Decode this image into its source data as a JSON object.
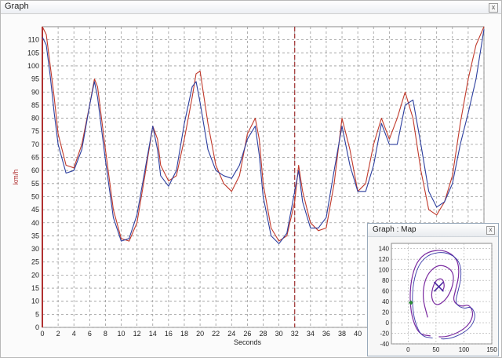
{
  "window": {
    "title": "Graph",
    "close_label": "x"
  },
  "chart_data": {
    "type": "line",
    "xlabel": "Seconds",
    "ylabel": "km/h",
    "xlim": [
      0,
      56
    ],
    "ylim": [
      0,
      115
    ],
    "xticks": [
      0,
      2,
      4,
      6,
      8,
      10,
      12,
      14,
      16,
      18,
      20,
      22,
      24,
      26,
      28,
      30,
      32,
      34,
      36,
      38,
      40
    ],
    "yticks": [
      0,
      5,
      10,
      15,
      20,
      25,
      30,
      35,
      40,
      45,
      50,
      55,
      60,
      65,
      70,
      75,
      80,
      85,
      90,
      95,
      100,
      105,
      110
    ],
    "marker_x": 32,
    "grid": true,
    "series": [
      {
        "color": "#c0392b",
        "points": [
          [
            0,
            115
          ],
          [
            0.5,
            112
          ],
          [
            1,
            100
          ],
          [
            1.5,
            88
          ],
          [
            2,
            74
          ],
          [
            3,
            62
          ],
          [
            4,
            61
          ],
          [
            5,
            70
          ],
          [
            6,
            85
          ],
          [
            6.6,
            95
          ],
          [
            7,
            92
          ],
          [
            8,
            68
          ],
          [
            9,
            45
          ],
          [
            10,
            34
          ],
          [
            11,
            33
          ],
          [
            12,
            40
          ],
          [
            13,
            58
          ],
          [
            14,
            77
          ],
          [
            14.6,
            72
          ],
          [
            15,
            62
          ],
          [
            16,
            56
          ],
          [
            17,
            58
          ],
          [
            18,
            72
          ],
          [
            19,
            88
          ],
          [
            19.5,
            97
          ],
          [
            20,
            98
          ],
          [
            21,
            78
          ],
          [
            22,
            62
          ],
          [
            23,
            55
          ],
          [
            24,
            52
          ],
          [
            25,
            58
          ],
          [
            26,
            74
          ],
          [
            27,
            80
          ],
          [
            27.5,
            72
          ],
          [
            28,
            55
          ],
          [
            29,
            38
          ],
          [
            30,
            33
          ],
          [
            31,
            35
          ],
          [
            32,
            48
          ],
          [
            32.5,
            62
          ],
          [
            33,
            52
          ],
          [
            34,
            40
          ],
          [
            35,
            37
          ],
          [
            36,
            38
          ],
          [
            37,
            55
          ],
          [
            38,
            80
          ],
          [
            39,
            68
          ],
          [
            40,
            52
          ],
          [
            41,
            55
          ],
          [
            42,
            70
          ],
          [
            43,
            80
          ],
          [
            44,
            72
          ],
          [
            45,
            80
          ],
          [
            46,
            90
          ],
          [
            47,
            80
          ],
          [
            48,
            60
          ],
          [
            49,
            45
          ],
          [
            50,
            43
          ],
          [
            51,
            48
          ],
          [
            52,
            58
          ],
          [
            53,
            78
          ],
          [
            54,
            95
          ],
          [
            55,
            108
          ],
          [
            56,
            115
          ]
        ]
      },
      {
        "color": "#2c3e9e",
        "points": [
          [
            0,
            111
          ],
          [
            0.5,
            108
          ],
          [
            1,
            96
          ],
          [
            1.5,
            82
          ],
          [
            2,
            70
          ],
          [
            3,
            59
          ],
          [
            4,
            60
          ],
          [
            5,
            68
          ],
          [
            6,
            85
          ],
          [
            6.6,
            94
          ],
          [
            7,
            88
          ],
          [
            8,
            64
          ],
          [
            9,
            42
          ],
          [
            10,
            33
          ],
          [
            11,
            34
          ],
          [
            12,
            43
          ],
          [
            13,
            60
          ],
          [
            14,
            77
          ],
          [
            14.6,
            68
          ],
          [
            15,
            58
          ],
          [
            16,
            54
          ],
          [
            17,
            60
          ],
          [
            18,
            78
          ],
          [
            19,
            92
          ],
          [
            19.5,
            94
          ],
          [
            20,
            86
          ],
          [
            21,
            68
          ],
          [
            22,
            60
          ],
          [
            23,
            58
          ],
          [
            24,
            57
          ],
          [
            25,
            62
          ],
          [
            26,
            72
          ],
          [
            27,
            77
          ],
          [
            27.5,
            66
          ],
          [
            28,
            50
          ],
          [
            29,
            35
          ],
          [
            30,
            32
          ],
          [
            31,
            36
          ],
          [
            32,
            52
          ],
          [
            32.5,
            60
          ],
          [
            33,
            48
          ],
          [
            34,
            38
          ],
          [
            35,
            38
          ],
          [
            36,
            42
          ],
          [
            37,
            60
          ],
          [
            38,
            77
          ],
          [
            39,
            62
          ],
          [
            40,
            52
          ],
          [
            41,
            52
          ],
          [
            42,
            62
          ],
          [
            43,
            78
          ],
          [
            44,
            70
          ],
          [
            45,
            70
          ],
          [
            46,
            85
          ],
          [
            47,
            87
          ],
          [
            48,
            70
          ],
          [
            49,
            52
          ],
          [
            50,
            46
          ],
          [
            51,
            48
          ],
          [
            52,
            55
          ],
          [
            53,
            70
          ],
          [
            54,
            82
          ],
          [
            55,
            95
          ],
          [
            56,
            114
          ]
        ]
      }
    ]
  },
  "map": {
    "title": "Graph : Map",
    "close_label": "x",
    "chart_data": {
      "type": "scatter",
      "xlim": [
        -30,
        150
      ],
      "ylim": [
        -40,
        150
      ],
      "xticks": [
        0,
        50,
        100,
        150
      ],
      "yticks": [
        -40,
        -20,
        0,
        20,
        40,
        60,
        80,
        100,
        120,
        140
      ],
      "track_color": "#7a2aa0",
      "cross": [
        55,
        68
      ],
      "start_marker": [
        5,
        38
      ],
      "track": [
        [
          40,
          -25
        ],
        [
          20,
          -22
        ],
        [
          8,
          5
        ],
        [
          3,
          40
        ],
        [
          5,
          80
        ],
        [
          15,
          115
        ],
        [
          35,
          135
        ],
        [
          65,
          138
        ],
        [
          88,
          122
        ],
        [
          92,
          92
        ],
        [
          85,
          62
        ],
        [
          80,
          40
        ],
        [
          95,
          30
        ],
        [
          110,
          35
        ],
        [
          118,
          15
        ],
        [
          105,
          -10
        ],
        [
          70,
          -28
        ],
        [
          40,
          -25
        ]
      ],
      "inner_track": [
        [
          35,
          10
        ],
        [
          25,
          50
        ],
        [
          32,
          90
        ],
        [
          55,
          112
        ],
        [
          80,
          100
        ],
        [
          82,
          75
        ],
        [
          70,
          45
        ],
        [
          50,
          30
        ],
        [
          40,
          50
        ],
        [
          48,
          80
        ],
        [
          62,
          85
        ],
        [
          66,
          65
        ],
        [
          55,
          55
        ]
      ]
    }
  }
}
